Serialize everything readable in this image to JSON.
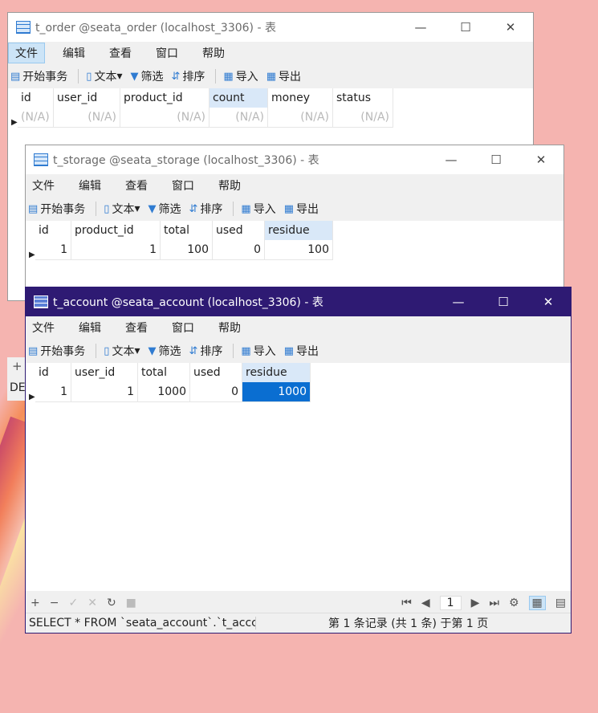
{
  "menu": [
    "文件",
    "编辑",
    "查看",
    "窗口",
    "帮助"
  ],
  "toolbar": {
    "begin_tx": "开始事务",
    "text": "文本",
    "filter": "筛选",
    "sort": "排序",
    "import": "导入",
    "export": "导出",
    "icons": [
      "database-icon",
      "document-icon",
      "filter-icon",
      "sort-icon",
      "import-icon",
      "export-icon"
    ]
  },
  "win_controls": {
    "min": "—",
    "max": "☐",
    "close": "✕"
  },
  "order": {
    "title": "t_order @seata_order (localhost_3306) - 表",
    "columns": [
      "id",
      "user_id",
      "product_id",
      "count",
      "money",
      "status"
    ],
    "row": [
      "(N/A)",
      "(N/A)",
      "(N/A)",
      "(N/A)",
      "(N/A)",
      "(N/A)"
    ]
  },
  "storage": {
    "title": "t_storage @seata_storage (localhost_3306) - 表",
    "columns": [
      "id",
      "product_id",
      "total",
      "used",
      "residue"
    ],
    "row": [
      "1",
      "1",
      "100",
      "0",
      "100"
    ]
  },
  "account": {
    "title": "t_account @seata_account (localhost_3306) - 表",
    "columns": [
      "id",
      "user_id",
      "total",
      "used",
      "residue"
    ],
    "row": [
      "1",
      "1",
      "1000",
      "0",
      "1000"
    ],
    "page": "1",
    "sql": "SELECT * FROM `seata_account`.`t_accc",
    "record_info": "第 1 条记录 (共 1 条) 于第 1 页"
  },
  "partial": {
    "add": "+",
    "de": "DE"
  },
  "colors": {
    "active_title": "#2e1a73",
    "selection": "#0a6ed1",
    "header_highlight": "#d9e8f8",
    "desktop": "#f5b4b0"
  }
}
